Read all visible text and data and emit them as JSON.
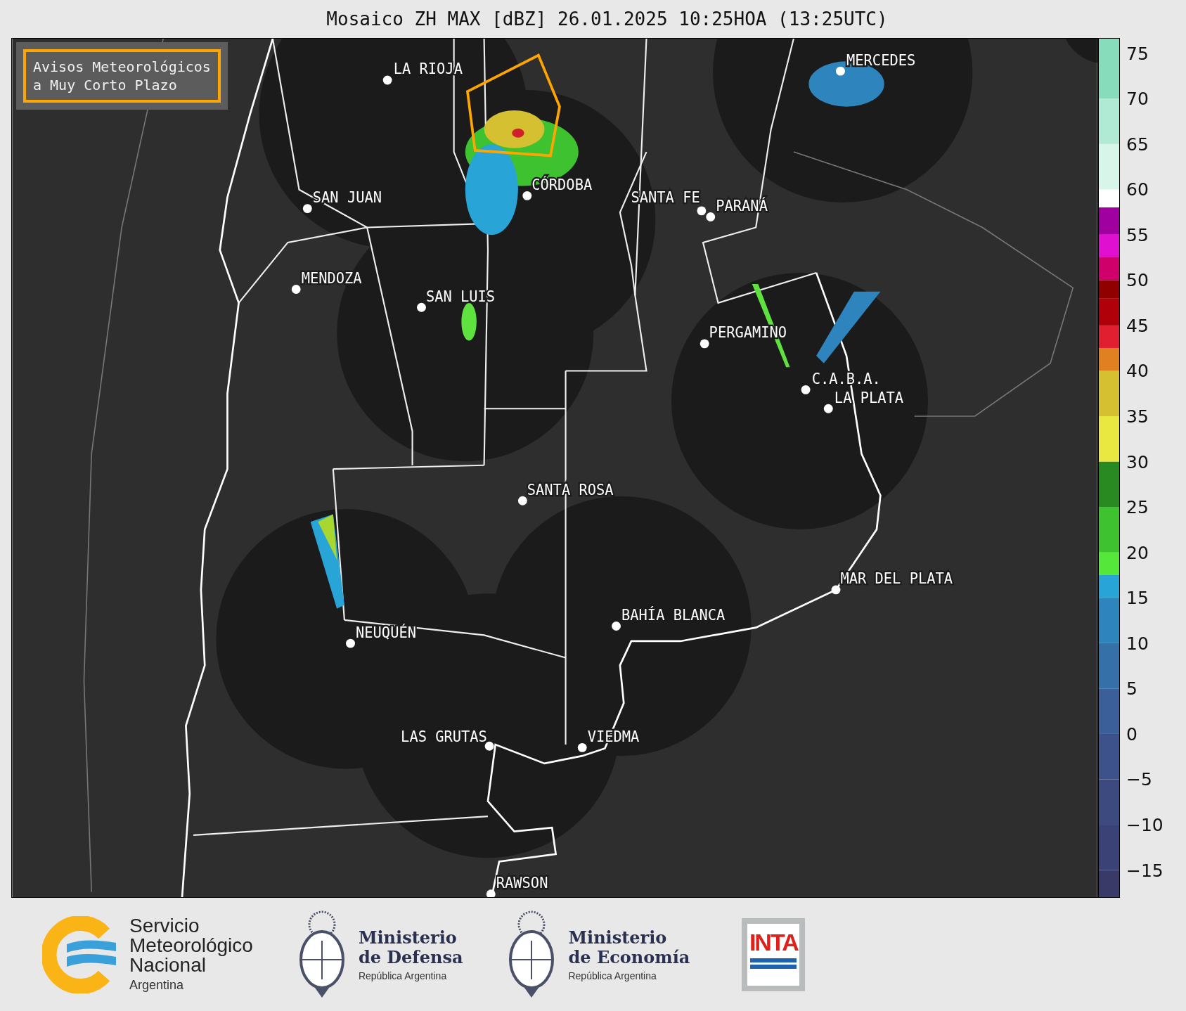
{
  "title": "Mosaico ZH MAX [dBZ] 26.01.2025 10:25HOA (13:25UTC)",
  "legend": {
    "lines": [
      "Avisos Meteorológicos",
      "a Muy Corto Plazo"
    ]
  },
  "cities": [
    {
      "name": "LA RIOJA"
    },
    {
      "name": "MERCEDES"
    },
    {
      "name": "CÓRDOBA"
    },
    {
      "name": "SAN JUAN"
    },
    {
      "name": "SANTA FE"
    },
    {
      "name": "PARANÁ"
    },
    {
      "name": "MENDOZA"
    },
    {
      "name": "SAN LUIS"
    },
    {
      "name": "PERGAMINO"
    },
    {
      "name": "C.A.B.A."
    },
    {
      "name": "LA PLATA"
    },
    {
      "name": "SANTA ROSA"
    },
    {
      "name": "MAR DEL PLATA"
    },
    {
      "name": "BAHÍA BLANCA"
    },
    {
      "name": "NEUQUÉN"
    },
    {
      "name": "LAS GRUTAS"
    },
    {
      "name": "VIEDMA"
    },
    {
      "name": "RAWSON"
    }
  ],
  "colorbar": {
    "ticks": [
      "75",
      "70",
      "65",
      "60",
      "55",
      "50",
      "45",
      "40",
      "35",
      "30",
      "25",
      "20",
      "15",
      "10",
      "5",
      "0",
      "−5",
      "−10",
      "−15"
    ]
  },
  "footer": {
    "smn": {
      "lines": [
        "Servicio",
        "Meteorológico",
        "Nacional"
      ],
      "country": "Argentina"
    },
    "defensa": {
      "lines": [
        "Ministerio",
        "de Defensa"
      ],
      "country": "República Argentina"
    },
    "economia": {
      "lines": [
        "Ministerio",
        "de Economía"
      ],
      "country": "República Argentina"
    },
    "inta": {
      "text": "INTA"
    }
  }
}
